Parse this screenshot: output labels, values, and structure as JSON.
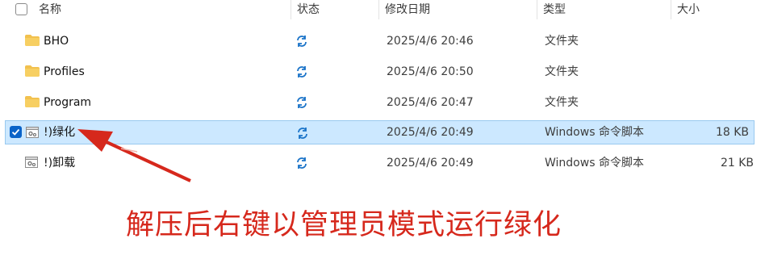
{
  "header": {
    "name_label": "名称",
    "status_label": "状态",
    "date_label": "修改日期",
    "type_label": "类型",
    "size_label": "大小"
  },
  "files": [
    {
      "name": "BHO",
      "status_icon": "sync-icon",
      "date": "2025/4/6 20:46",
      "type": "文件夹",
      "size": "",
      "icon": "folder-icon",
      "selected": false
    },
    {
      "name": "Profiles",
      "status_icon": "sync-icon",
      "date": "2025/4/6 20:50",
      "type": "文件夹",
      "size": "",
      "icon": "folder-icon",
      "selected": false
    },
    {
      "name": "Program",
      "status_icon": "sync-icon",
      "date": "2025/4/6 20:47",
      "type": "文件夹",
      "size": "",
      "icon": "folder-icon",
      "selected": false
    },
    {
      "name": "!)绿化",
      "status_icon": "sync-icon",
      "date": "2025/4/6 20:49",
      "type": "Windows 命令脚本",
      "size": "18 KB",
      "icon": "script-icon",
      "selected": true
    },
    {
      "name": "!)卸载",
      "status_icon": "sync-icon",
      "date": "2025/4/6 20:49",
      "type": "Windows 命令脚本",
      "size": "21 KB",
      "icon": "script-icon",
      "selected": false
    }
  ],
  "annotation": {
    "text": "解压后右键以管理员模式运行绿化",
    "color": "#d6281c"
  },
  "colors": {
    "selection_bg": "#cce8ff",
    "selection_border": "#99c9ef",
    "folder": "#f2c14e",
    "sync": "#1a73c8",
    "checkbox": "#0a63c8"
  }
}
